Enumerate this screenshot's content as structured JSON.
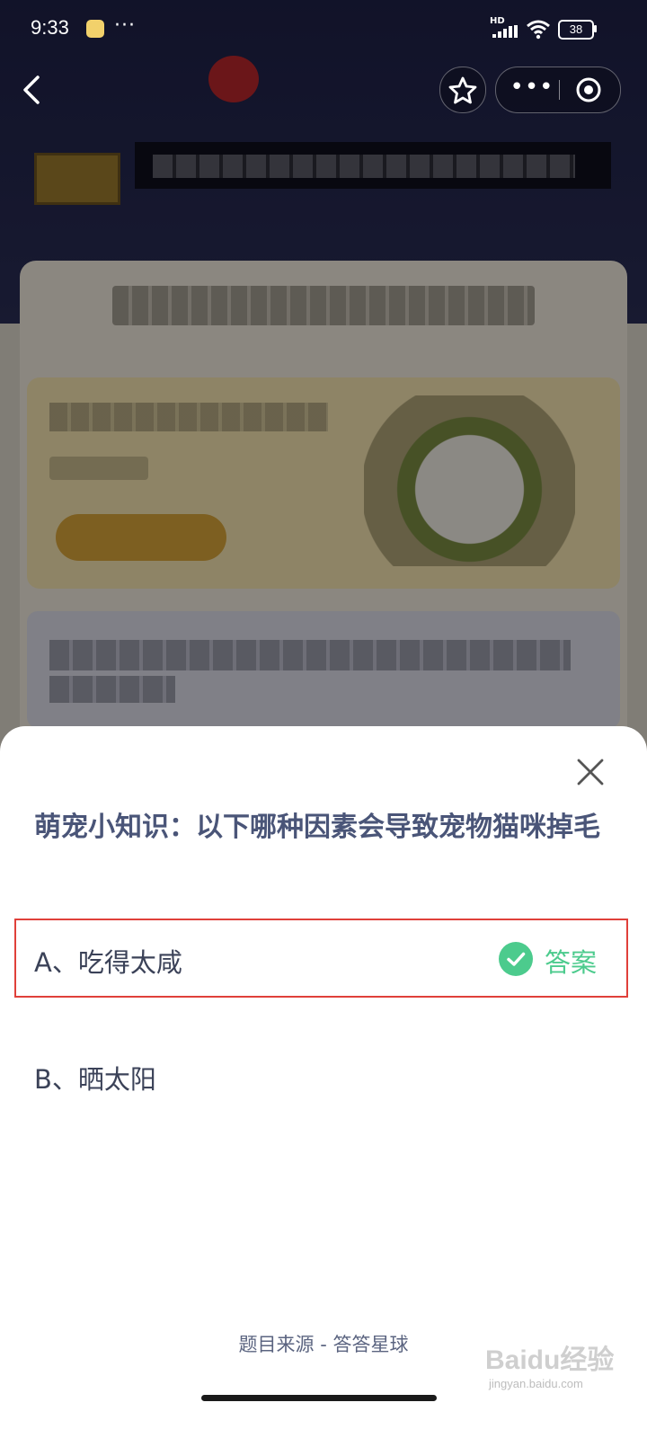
{
  "status_bar": {
    "time": "9:33",
    "more": "···",
    "network": "HD",
    "battery": "38"
  },
  "nav": {
    "more": "•••"
  },
  "sheet": {
    "question": "萌宠小知识：以下哪种因素会导致宠物猫咪掉毛",
    "options": [
      {
        "label": "A、吃得太咸",
        "is_answer": true,
        "answer_tag": "答案"
      },
      {
        "label": "B、晒太阳",
        "is_answer": false
      }
    ],
    "source": "题目来源 - 答答星球"
  },
  "watermark": {
    "main": "Baidu经验",
    "sub": "jingyan.baidu.com"
  },
  "colors": {
    "question_text": "#4a5578",
    "answer_green": "#4ccb8d",
    "highlight_border": "#e0403a"
  }
}
